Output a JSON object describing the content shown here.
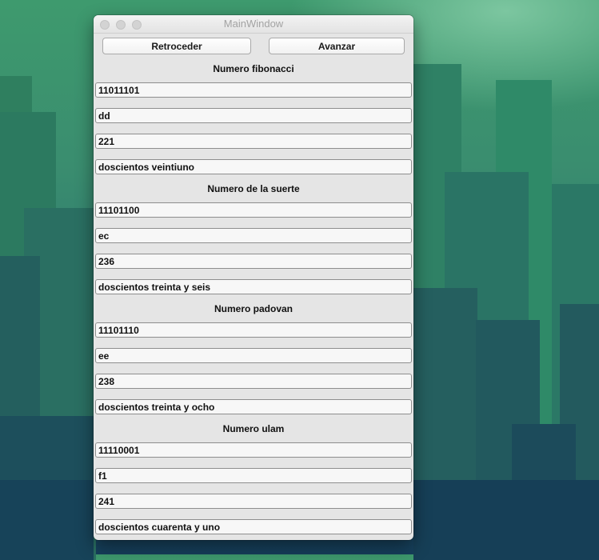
{
  "window": {
    "title": "MainWindow"
  },
  "toolbar": {
    "back_label": "Retroceder",
    "forward_label": "Avanzar"
  },
  "sections": [
    {
      "label": "Numero fibonacci",
      "binary": "11011101",
      "hex": "dd",
      "decimal": "221",
      "words": "doscientos veintiuno"
    },
    {
      "label": "Numero de la suerte",
      "binary": "11101100",
      "hex": "ec",
      "decimal": "236",
      "words": "doscientos treinta y seis"
    },
    {
      "label": "Numero padovan",
      "binary": "11101110",
      "hex": "ee",
      "decimal": "238",
      "words": "doscientos treinta y ocho"
    },
    {
      "label": "Numero ulam",
      "binary": "11110001",
      "hex": "f1",
      "decimal": "241",
      "words": "doscientos cuarenta y uno"
    }
  ]
}
